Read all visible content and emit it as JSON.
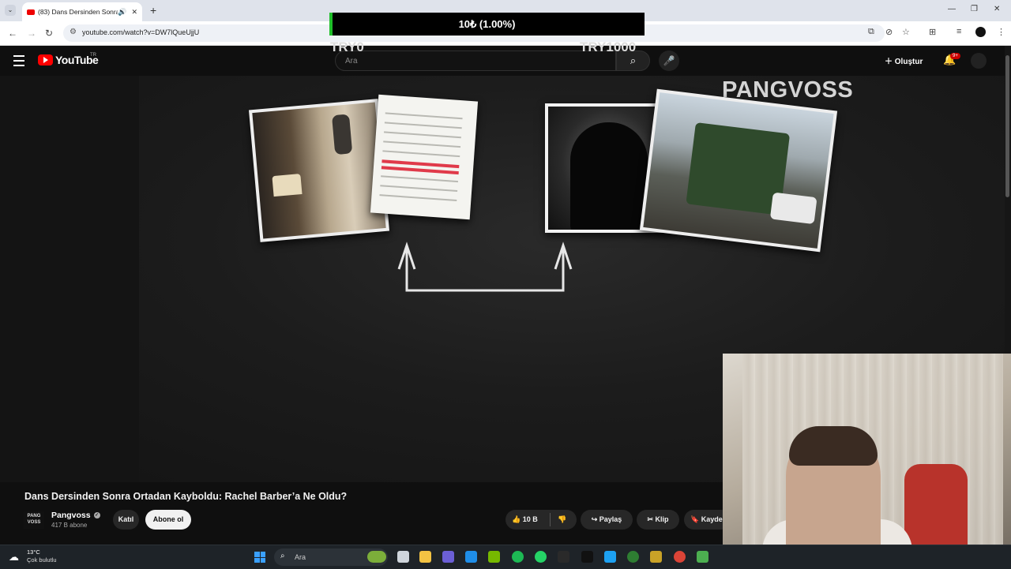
{
  "browser": {
    "tab_title": "(83) Dans Dersinden Sonra",
    "url": "youtube.com/watch?v=DW7lQueUjjU",
    "new_tab": "+",
    "tab_list": "⌄"
  },
  "donation": {
    "progress_text": "10₺ (1.00%)",
    "progress_percent": 1.0,
    "min_label": "TRY0",
    "max_label": "TRY1000"
  },
  "youtube": {
    "logo_text": "YouTube",
    "country_code": "TR",
    "search_placeholder": "Ara",
    "create_label": "Oluştur",
    "notification_badge": "9+"
  },
  "video": {
    "brand_overlay": "PANGVOSS",
    "title": "Dans Dersinden Sonra Ortadan Kayboldu: Rachel Barber’a Ne Oldu?",
    "channel_name": "Pangvoss",
    "channel_logo_text": "PANG VOSS",
    "subscribers": "417 B abone",
    "join_label": "Katıl",
    "subscribe_label": "Abone ol",
    "like_count": "10 B",
    "share_label": "Paylaş",
    "clip_label": "Klip",
    "save_label": "Kayde"
  },
  "taskbar": {
    "temperature": "13°C",
    "condition": "Çok bulutlu",
    "search_label": "Ara"
  },
  "colors": {
    "progress_fill": "#1fbf2a",
    "yt_red": "#ff0000",
    "subscribe_bg": "#f1f1f1"
  }
}
